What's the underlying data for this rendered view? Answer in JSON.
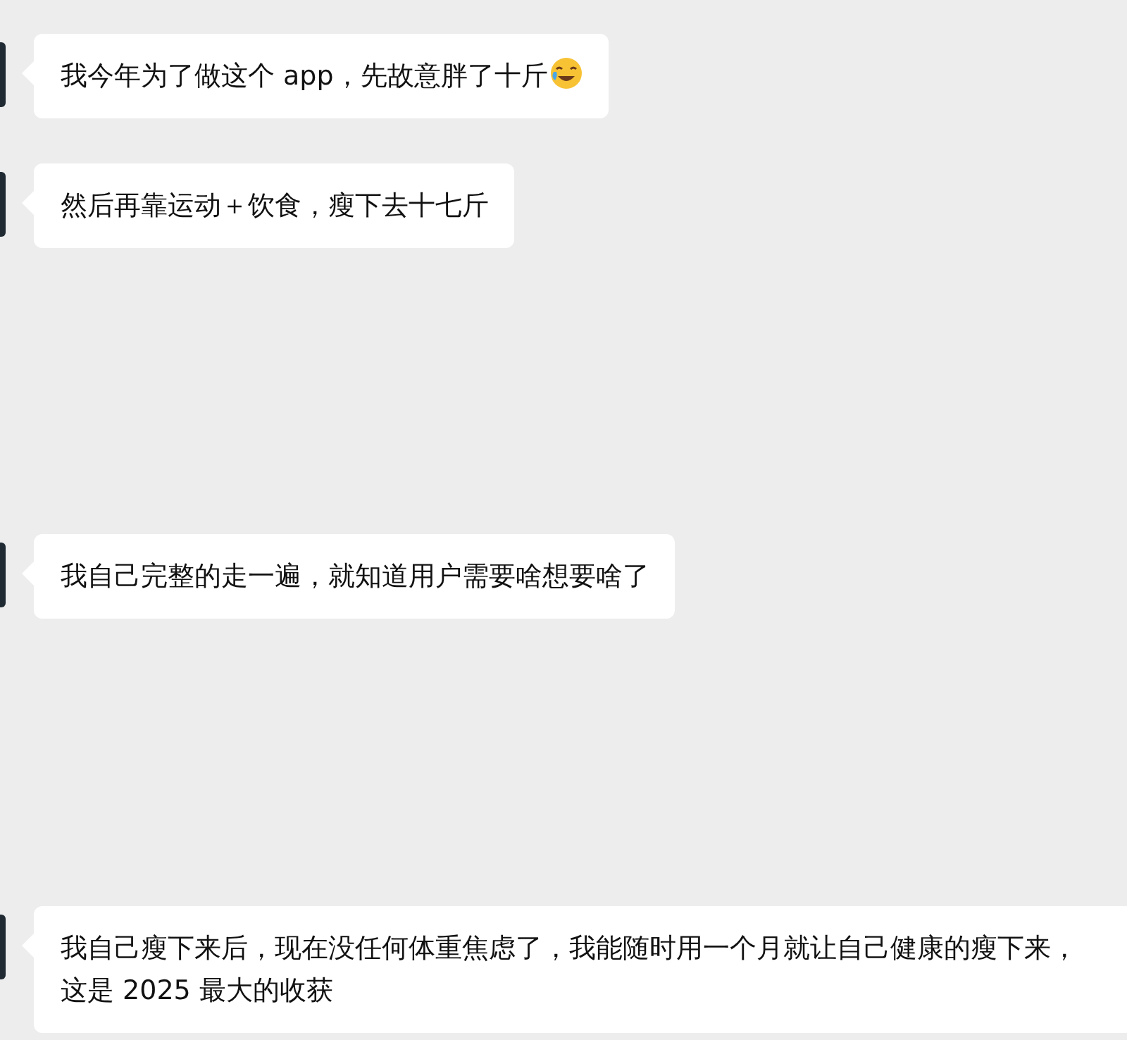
{
  "messages": [
    {
      "text": "我今年为了做这个 app，先故意胖了十斤",
      "emoji": true
    },
    {
      "text": "然后再靠运动＋饮食，瘦下去十七斤",
      "emoji": false
    },
    {
      "text": "我自己完整的走一遍，就知道用户需要啥想要啥了",
      "emoji": false
    },
    {
      "text": "我自己瘦下来后，现在没任何体重焦虑了，我能随时用一个月就让自己健康的瘦下来，这是 2025 最大的收获",
      "emoji": false
    }
  ]
}
